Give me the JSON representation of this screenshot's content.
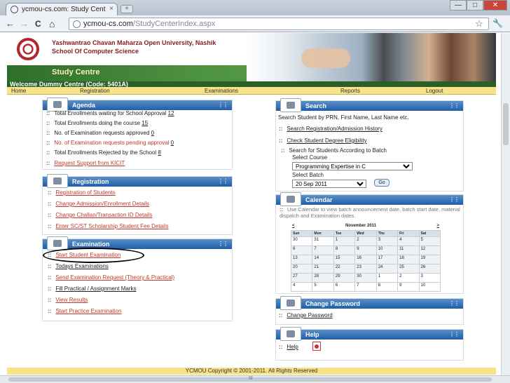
{
  "browser": {
    "tab_title": "ycmou-cs.com: Study Cent",
    "tab_close": "×",
    "new_tab": "+",
    "url_host": "ycmou-cs.com",
    "url_path": "/StudyCenterIndex.aspx",
    "back": "←",
    "forward": "→",
    "reload": "C",
    "home": "⌂",
    "star": "☆",
    "wrench": "🔧",
    "min": "—",
    "max": "□",
    "close": "✕"
  },
  "header": {
    "university_line1": "Yashwantrao Chavan Maharza Open University, Nashik",
    "university_line2": "School Of Computer Science",
    "study_centre": "Study Centre",
    "welcome": "Welcome Dummy Centre (Code: 5401A)"
  },
  "menu": {
    "home": "Home",
    "registration": "Registration",
    "examinations": "Examinations",
    "reports": "Reports",
    "logout": "Logout"
  },
  "agenda": {
    "title": "Agenda",
    "items": [
      {
        "label": "Total Enrollments waiting for School Approval",
        "count": "12"
      },
      {
        "label": "Total Enrollments doing the course",
        "count": "15"
      },
      {
        "label": "No. of Examination requests approved",
        "count": "0"
      },
      {
        "label": "No. of Examination requests pending approval",
        "count": "0"
      },
      {
        "label": "Total Enrollments Rejected by the School",
        "count": "8"
      }
    ],
    "support_link": "Request Support from KICIT"
  },
  "registration": {
    "title": "Registration",
    "links": [
      "Registration of Students",
      "Change Admission/Enrollment Details",
      "Change Challan/Transaction ID Details",
      "Enter SC/ST Scholarship Student Fee Details"
    ]
  },
  "examination": {
    "title": "Examination",
    "links": [
      "Start Student Examination",
      "Todays Examinations",
      "Send Examination Request (Theory & Practical)",
      "Fill Practical / Assignment Marks",
      "View Results",
      "Start Practice Examination"
    ]
  },
  "search": {
    "title": "Search",
    "intro": "Search Student by PRN, First Name, Last Name etc.",
    "link1": "Search Registration/Admission History",
    "link2": "Check Student Degree Eligibility",
    "batch_heading": "Search for Students According to Batch",
    "course_label": "Select Course",
    "course_value": "Programming Expertise in C",
    "batch_label": "Select Batch",
    "batch_value": "20 Sep 2011",
    "go": "Go"
  },
  "calendar": {
    "title": "Calendar",
    "intro": "Use Calendar to view batch announcement date, batch start date, material dispatch and Examination dates.",
    "prev": "<",
    "next": ">",
    "month": "November 2011",
    "days": [
      "Sun",
      "Mon",
      "Tue",
      "Wed",
      "Thu",
      "Fri",
      "Sat"
    ],
    "weeks": [
      [
        "30",
        "31",
        "1",
        "2",
        "3",
        "4",
        "5"
      ],
      [
        "6",
        "7",
        "8",
        "9",
        "10",
        "11",
        "12"
      ],
      [
        "13",
        "14",
        "15",
        "16",
        "17",
        "18",
        "19"
      ],
      [
        "20",
        "21",
        "22",
        "23",
        "24",
        "25",
        "26"
      ],
      [
        "27",
        "28",
        "29",
        "30",
        "1",
        "2",
        "3"
      ],
      [
        "4",
        "5",
        "6",
        "7",
        "8",
        "9",
        "10"
      ]
    ]
  },
  "password": {
    "title": "Change Password",
    "link": "Change Password"
  },
  "help": {
    "title": "Help",
    "link": "Help"
  },
  "footer": "YCMOU Copyright © 2001-2011. All Rights Reserved",
  "hscroll_mark": "III"
}
